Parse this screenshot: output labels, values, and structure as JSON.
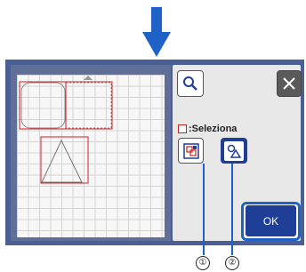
{
  "panel": {
    "select_label": ":Seleziona",
    "ok_label": "OK"
  },
  "callouts": [
    "①",
    "②"
  ],
  "icons": {
    "down_arrow": "down-arrow-icon",
    "search": "magnifier-icon",
    "close": "close-icon",
    "select_all": "select-all-icon",
    "select_one": "select-single-icon"
  },
  "colors": {
    "accent": "#1f3f97",
    "arrow": "#1e62c8",
    "screen_bg": "#4a5f95",
    "selection": "#d02020",
    "close_bg": "#5a5a5a"
  }
}
